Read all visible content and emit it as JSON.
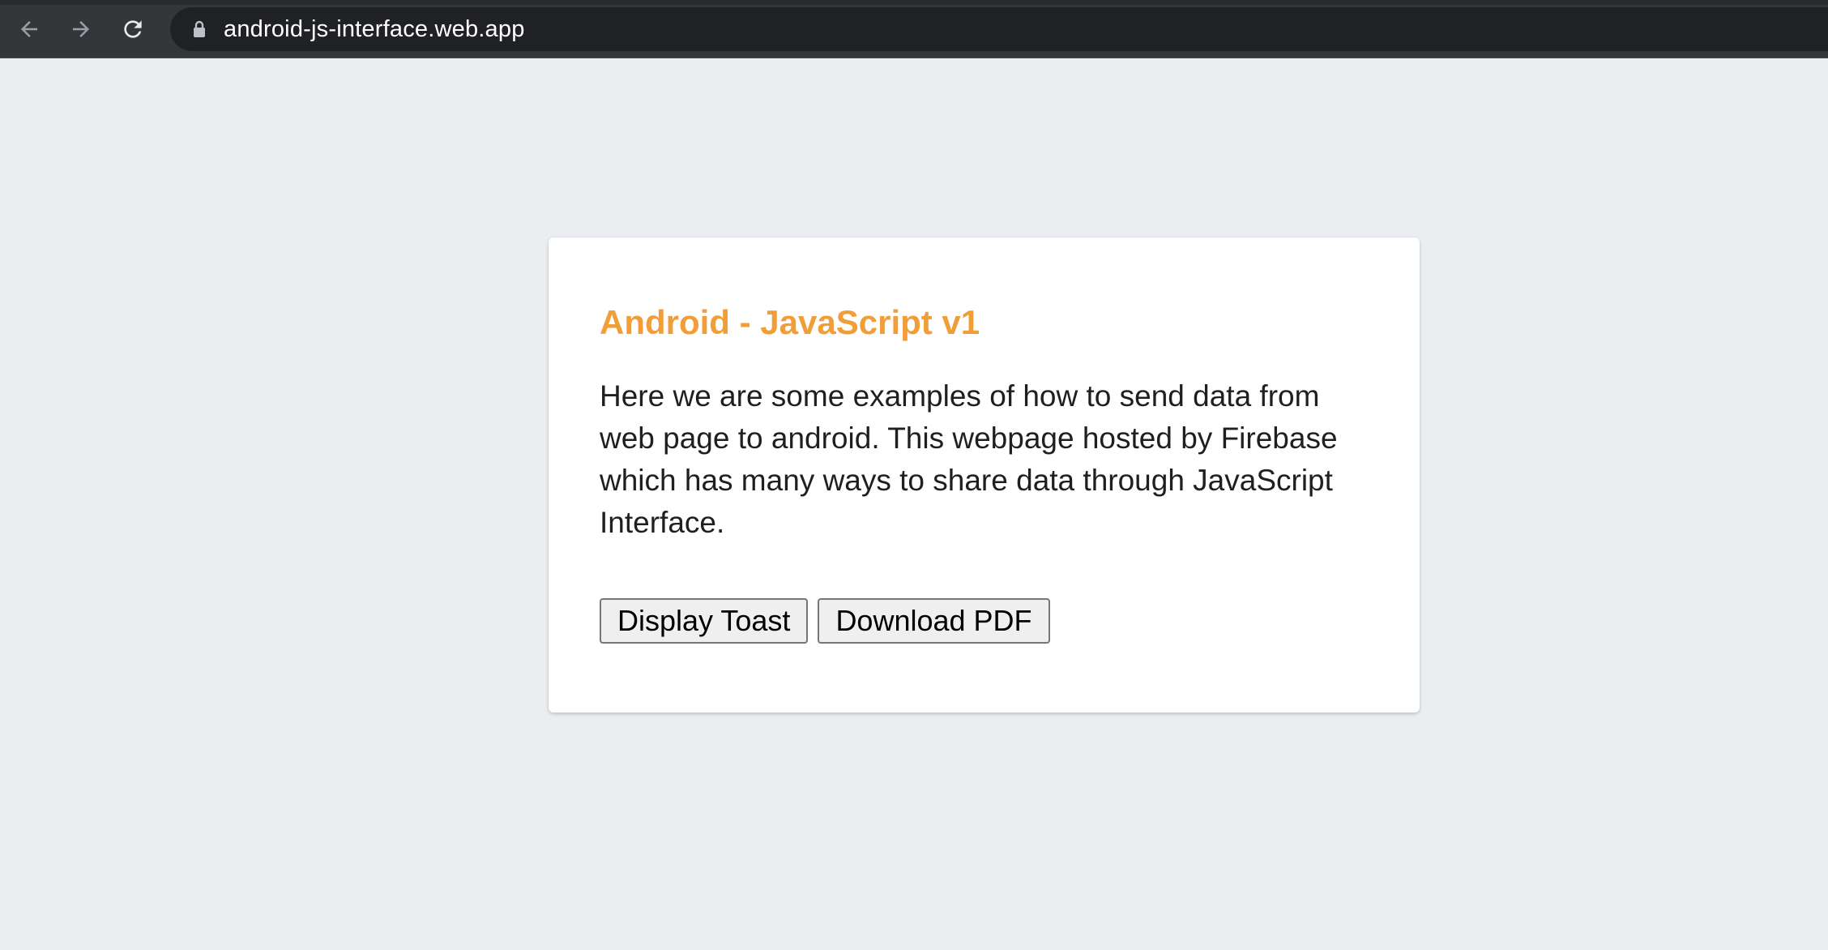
{
  "browser": {
    "url": "android-js-interface.web.app",
    "icons": {
      "back": "arrow-left-icon",
      "forward": "arrow-right-icon",
      "reload": "reload-icon",
      "lock": "lock-icon"
    }
  },
  "card": {
    "title": "Android - JavaScript v1",
    "description": "Here we are some examples of how to send data from web page to android. This webpage hosted by Firebase which has many ways to share data through JavaScript Interface.",
    "buttons": {
      "display_toast": "Display Toast",
      "download_pdf": "Download PDF"
    }
  },
  "colors": {
    "page_background": "#eaeef1",
    "title_accent": "#f19e38",
    "toolbar": "#35363a",
    "omnibox": "#202124"
  }
}
